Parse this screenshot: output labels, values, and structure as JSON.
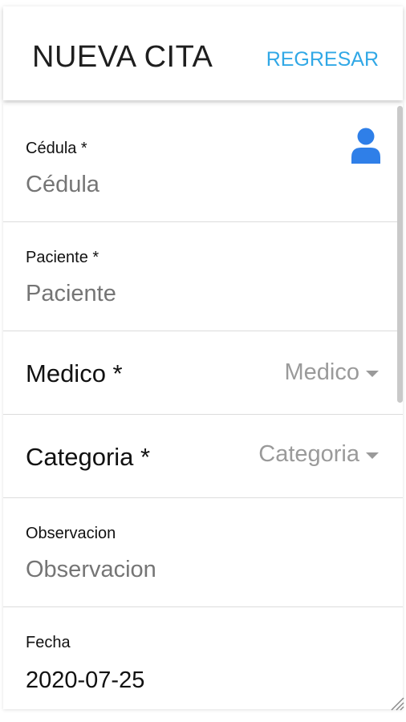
{
  "header": {
    "title": "NUEVA CITA",
    "back_label": "REGRESAR"
  },
  "fields": {
    "cedula": {
      "label": "Cédula *",
      "placeholder": "Cédula",
      "icon": "person-icon"
    },
    "paciente": {
      "label": "Paciente *",
      "placeholder": "Paciente"
    },
    "medico": {
      "label": "Medico *",
      "selected": "Medico"
    },
    "categoria": {
      "label": "Categoria *",
      "selected": "Categoria"
    },
    "observacion": {
      "label": "Observacion",
      "placeholder": "Observacion"
    },
    "fecha": {
      "label": "Fecha",
      "value": "2020-07-25"
    }
  },
  "colors": {
    "accent": "#31a8e6",
    "icon_blue": "#2f7fe8",
    "placeholder": "#9a9a9a",
    "divider": "#dcdcdc"
  }
}
